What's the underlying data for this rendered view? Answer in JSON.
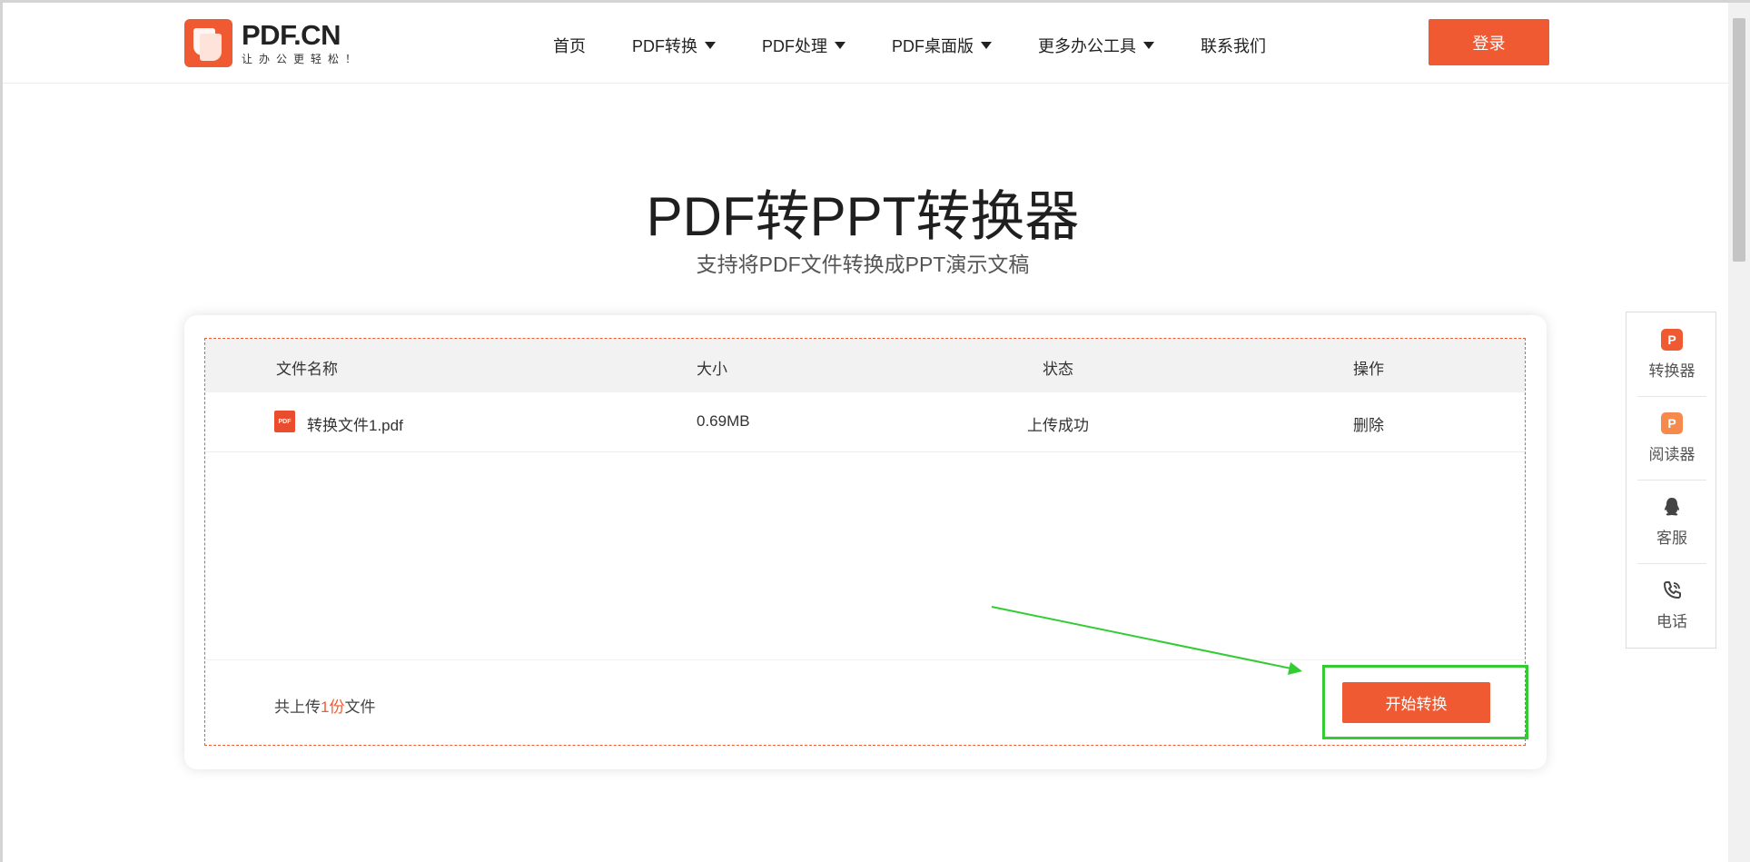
{
  "header": {
    "logo_title": "PDF.CN",
    "logo_slogan": "让办公更轻松！",
    "nav": [
      {
        "label": "首页",
        "has_dropdown": false
      },
      {
        "label": "PDF转换",
        "has_dropdown": true
      },
      {
        "label": "PDF处理",
        "has_dropdown": true
      },
      {
        "label": "PDF桌面版",
        "has_dropdown": true
      },
      {
        "label": "更多办公工具",
        "has_dropdown": true
      },
      {
        "label": "联系我们",
        "has_dropdown": false
      }
    ],
    "login_label": "登录"
  },
  "hero": {
    "title": "PDF转PPT转换器",
    "subtitle": "支持将PDF文件转换成PPT演示文稿"
  },
  "table": {
    "headers": [
      "文件名称",
      "大小",
      "状态",
      "操作"
    ],
    "rows": [
      {
        "icon_text": "PDF",
        "name": "转换文件1.pdf",
        "size": "0.69MB",
        "status": "上传成功",
        "action": "删除"
      }
    ]
  },
  "footer": {
    "count_prefix": "共上传",
    "count_num": "1份",
    "count_suffix": "文件",
    "start_label": "开始转换"
  },
  "side_panel": [
    {
      "label": "转换器",
      "icon": "converter-icon",
      "color": "#f05a32"
    },
    {
      "label": "阅读器",
      "icon": "reader-icon",
      "color": "#f58a4c"
    },
    {
      "label": "客服",
      "icon": "qq-icon",
      "color": "#444444"
    },
    {
      "label": "电话",
      "icon": "phone-icon",
      "color": "#444444"
    }
  ],
  "colors": {
    "accent": "#f05a32",
    "annotation": "#33cc33"
  }
}
